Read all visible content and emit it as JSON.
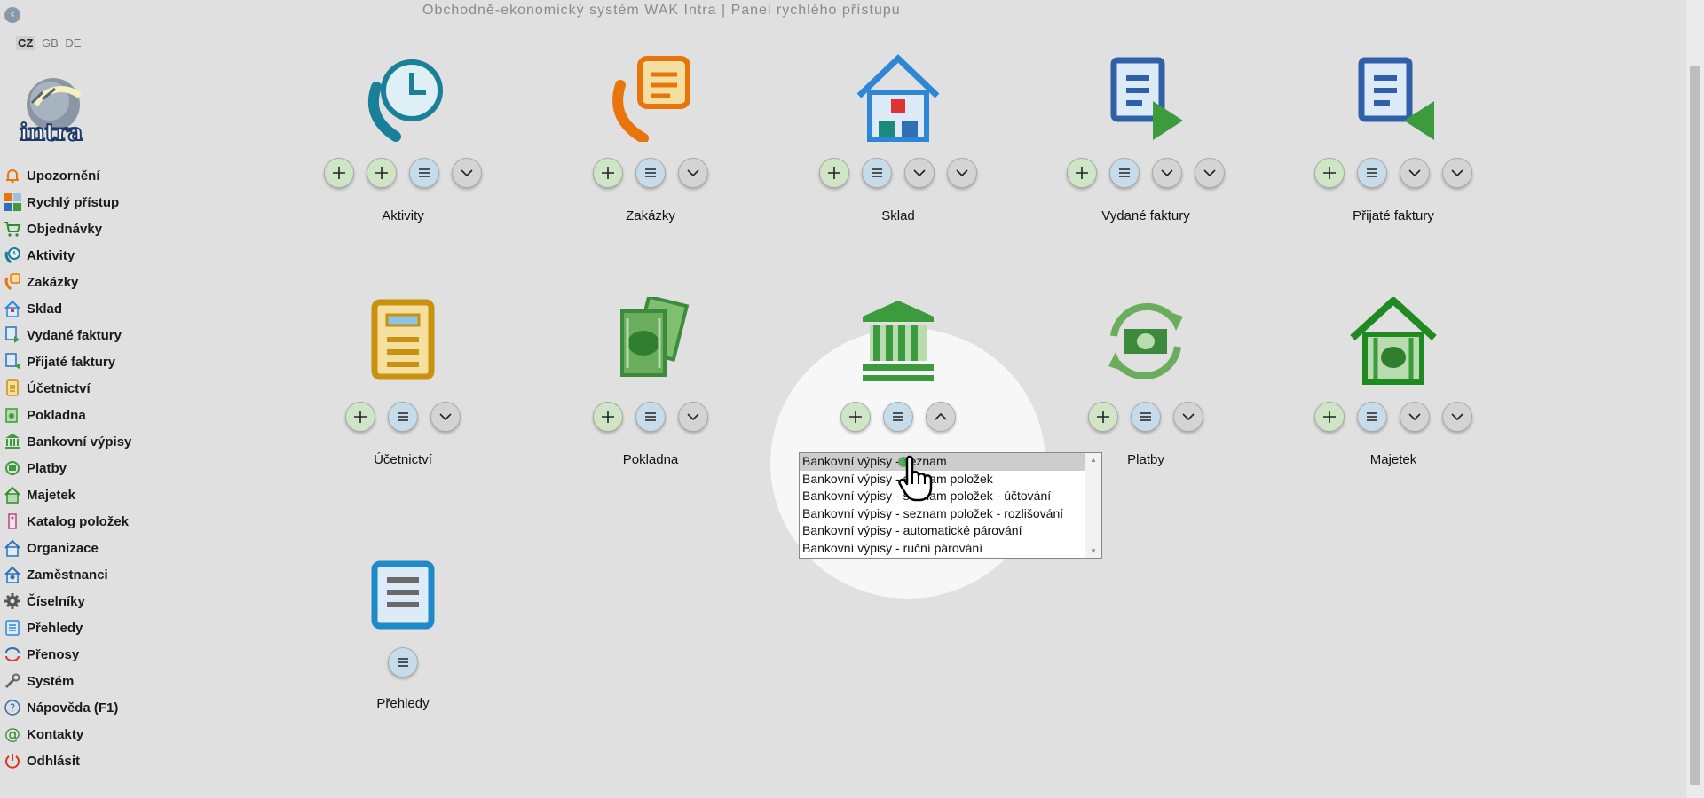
{
  "header": {
    "title": "Obchodně-ekonomický systém WAK Intra | Panel rychlého přístupu"
  },
  "languages": [
    "CZ",
    "GB",
    "DE"
  ],
  "logo": {
    "text": "intra"
  },
  "sidebar": {
    "items": [
      {
        "label": "Upozornění"
      },
      {
        "label": "Rychlý přístup"
      },
      {
        "label": "Objednávky"
      },
      {
        "label": "Aktivity"
      },
      {
        "label": "Zakázky"
      },
      {
        "label": "Sklad"
      },
      {
        "label": "Vydané faktury"
      },
      {
        "label": "Přijaté faktury"
      },
      {
        "label": "Účetnictví"
      },
      {
        "label": "Pokladna"
      },
      {
        "label": "Bankovní výpisy"
      },
      {
        "label": "Platby"
      },
      {
        "label": "Majetek"
      },
      {
        "label": "Katalog položek"
      },
      {
        "label": "Organizace"
      },
      {
        "label": "Zaměstnanci"
      },
      {
        "label": "Číselníky"
      },
      {
        "label": "Přehledy"
      },
      {
        "label": "Přenosy"
      },
      {
        "label": "Systém"
      },
      {
        "label": "Nápověda (F1)"
      },
      {
        "label": "Kontakty"
      },
      {
        "label": "Odhlásit"
      }
    ]
  },
  "tiles": [
    {
      "label": "Aktivity",
      "icon": "activities-clock-phone-icon",
      "buttons": [
        "add",
        "add",
        "list",
        "expand"
      ]
    },
    {
      "label": "Zakázky",
      "icon": "orders-phone-chat-icon",
      "buttons": [
        "add",
        "list",
        "expand"
      ]
    },
    {
      "label": "Sklad",
      "icon": "warehouse-house-icon",
      "buttons": [
        "add",
        "list",
        "expand",
        "expand"
      ]
    },
    {
      "label": "Vydané faktury",
      "icon": "issued-invoice-icon",
      "buttons": [
        "add",
        "list",
        "expand",
        "expand"
      ]
    },
    {
      "label": "Přijaté faktury",
      "icon": "received-invoice-icon",
      "buttons": [
        "add",
        "list",
        "expand",
        "expand"
      ]
    },
    {
      "label": "Účetnictví",
      "icon": "accounting-document-icon",
      "buttons": [
        "add",
        "list",
        "expand"
      ]
    },
    {
      "label": "Pokladna",
      "icon": "cash-money-icon",
      "buttons": [
        "add",
        "list",
        "expand"
      ]
    },
    {
      "label": "Bankovní výpisy",
      "icon": "bank-building-icon",
      "buttons": [
        "add",
        "list",
        "collapse"
      ]
    },
    {
      "label": "Platby",
      "icon": "payments-cycle-icon",
      "buttons": [
        "add",
        "list",
        "expand"
      ]
    },
    {
      "label": "Majetek",
      "icon": "property-house-icon",
      "buttons": [
        "add",
        "list",
        "expand",
        "expand"
      ]
    },
    {
      "label": "Přehledy",
      "icon": "reports-list-icon",
      "buttons": [
        "list"
      ]
    }
  ],
  "dropdown": {
    "selected_index": 0,
    "options": [
      "Bankovní výpisy - seznam",
      "Bankovní výpisy - seznam položek",
      "Bankovní výpisy - seznam položek - účtování",
      "Bankovní výpisy - seznam položek - rozlišování",
      "Bankovní výpisy - automatické párování",
      "Bankovní výpisy - ruční párování"
    ]
  },
  "colors": {
    "background": "#e0e0e0",
    "add": "#cfe6c6",
    "list": "#c6dcea",
    "more": "#d4d4d4"
  }
}
